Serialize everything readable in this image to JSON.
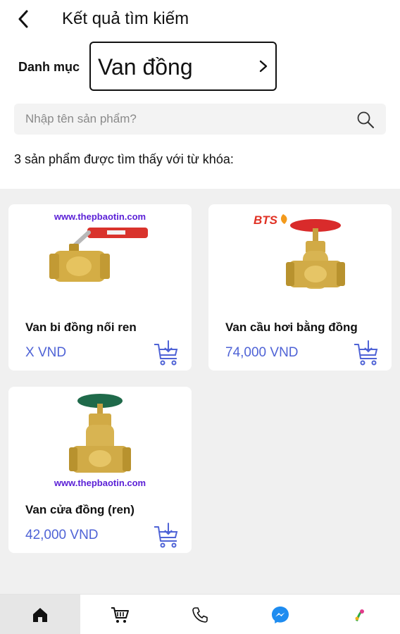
{
  "header": {
    "title": "Kết quả tìm kiếm",
    "back_icon": "chevron-left-icon"
  },
  "category": {
    "label": "Danh mục",
    "value": "Van đồng"
  },
  "search": {
    "placeholder": "Nhập tên sản phẩm?",
    "value": ""
  },
  "results": {
    "summary": "3 sản phẩm được tìm thấy với từ khóa:"
  },
  "products": [
    {
      "name": "Van bi đồng nối ren",
      "price": "X VND",
      "watermark": "www.thepbaotin.com"
    },
    {
      "name": "Van cầu hơi bằng đồng",
      "price": "74,000 VND",
      "watermark": "BTS"
    },
    {
      "name": "Van cửa đồng (ren)",
      "price": "42,000 VND",
      "watermark": "www.thepbaotin.com"
    }
  ],
  "tabbar": {
    "items": [
      {
        "icon": "home-icon",
        "active": true
      },
      {
        "icon": "cart-icon",
        "active": false
      },
      {
        "icon": "phone-icon",
        "active": false
      },
      {
        "icon": "messenger-icon",
        "active": false
      },
      {
        "icon": "zalo-icon",
        "active": false
      }
    ]
  },
  "colors": {
    "price": "#4f63d6",
    "background": "#f0f0f0",
    "tab_active": "#e6e6e6",
    "messenger": "#1e8cf0"
  }
}
